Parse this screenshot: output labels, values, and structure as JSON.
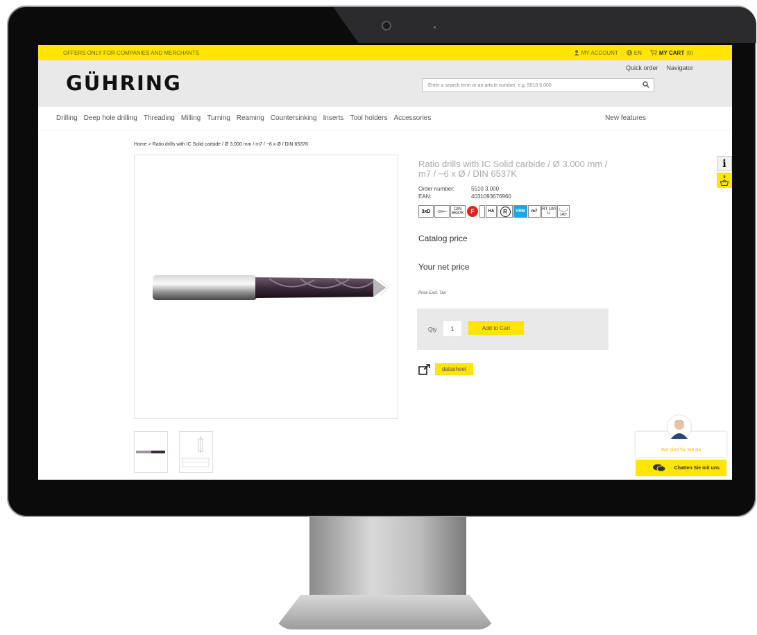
{
  "topbar": {
    "offer": "OFFERS ONLY FOR COMPANIES AND MERCHANTS",
    "account": "MY ACCOUNT",
    "lang": "EN",
    "cart": "MY CART",
    "cart_count": "(0)"
  },
  "header": {
    "logo": "GÜHRING",
    "quick_order": "Quick order",
    "navigator": "Navigator",
    "search_placeholder": "Enter a search term or an article number, e.g. 5510 5.000"
  },
  "nav": {
    "items": [
      "Drilling",
      "Deep hole drilling",
      "Threading",
      "Milling",
      "Turning",
      "Reaming",
      "Countersinking",
      "Inserts",
      "Tool holders",
      "Accessories"
    ],
    "new_features": "New features"
  },
  "breadcrumb": "Home > Ratio drills with IC Solid carbide / Ø 3.000 mm / m7 / ~6 x Ø / DIN 6537K",
  "product": {
    "title": "Ratio drills with IC Solid carbide / Ø 3.000 mm / m7 / ~6 x Ø / DIN 6537K",
    "order_number_label": "Order number:",
    "order_number": "5510 3.000",
    "ean_label": "EAN:",
    "ean": "4031093676960",
    "catalog_price": "Catalog price",
    "net_price": "Your net price",
    "price_note": "Price Excl. Tax",
    "qty_label": "Qty",
    "qty_value": "1",
    "add_to_cart": "Add to Cart",
    "datasheet": "datasheet"
  },
  "feature_icons": {
    "b1": "3xD",
    "b2_a": "DIN",
    "b2_b": "6537K",
    "b3": "F",
    "b4": "HA",
    "b5": "R",
    "b6": "VHM",
    "b7": "m7",
    "b8_a": "RT 100",
    "b8_b": "U",
    "b9": "140°"
  },
  "side": {
    "info": "i",
    "cart_count": "0"
  },
  "chat": {
    "greeting": "Wir sind für Sie da",
    "cta": "Chatten Sie mit uns"
  },
  "colors": {
    "brand_yellow": "#ffe500",
    "vhm_blue": "#1aa7e6",
    "f_red": "#e32219"
  }
}
